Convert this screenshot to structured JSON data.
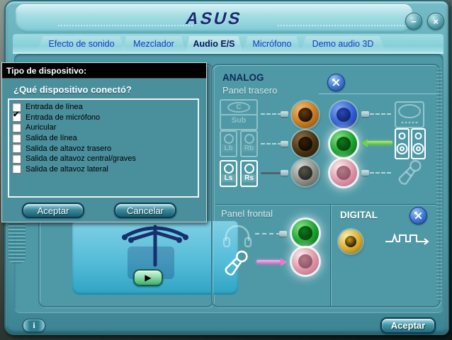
{
  "window": {
    "brand": "ASUS",
    "minimize_glyph": "−",
    "close_glyph": "×"
  },
  "tabs": [
    {
      "label": "Efecto de sonido"
    },
    {
      "label": "Mezclador"
    },
    {
      "label": "Audio E/S"
    },
    {
      "label": "Micrófono"
    },
    {
      "label": "Demo audio 3D"
    }
  ],
  "active_tab": "Audio E/S",
  "dialog": {
    "title": "Tipo de dispositivo:",
    "question": "¿Qué dispositivo conectó?",
    "options": [
      {
        "label": "Entrada de línea",
        "checked": false,
        "mark": ""
      },
      {
        "label": "Entrada de micrófono",
        "checked": true,
        "mark": "✔"
      },
      {
        "label": "Auricular",
        "checked": false,
        "mark": ""
      },
      {
        "label": "Salida de línea",
        "checked": false,
        "mark": ""
      },
      {
        "label": "Salida de altavoz trasero",
        "checked": false,
        "mark": ""
      },
      {
        "label": "Salida de altavoz central/graves",
        "checked": false,
        "mark": ""
      },
      {
        "label": "Salida de altavoz lateral",
        "checked": false,
        "mark": ""
      }
    ],
    "accept_label": "Aceptar",
    "cancel_label": "Cancelar"
  },
  "analog": {
    "title": "ANALOG",
    "rear_panel_label": "Panel trasero",
    "front_panel_label": "Panel frontal",
    "speakers": {
      "center": "C",
      "sub": "Sub",
      "left_back": "Lb",
      "right_back": "Rb",
      "left_side": "Ls",
      "right_side": "Rs"
    }
  },
  "digital": {
    "title": "DIGITAL"
  },
  "player": {
    "play_glyph": "▶"
  },
  "footer": {
    "info_glyph": "i",
    "accept_label": "Aceptar"
  },
  "colors": {
    "jack_orange": "#c6791f",
    "jack_black": "#473113",
    "jack_gray": "#8d8d88",
    "jack_blue": "#2e5fd2",
    "jack_green": "#17a12b",
    "jack_pink": "#dd93a5",
    "jack_gold": "#d6ab2e",
    "window_teal": "#57a3b0",
    "panel_teal": "#4f99a6",
    "tab_blue": "#1538cc",
    "active_tab_navy": "#0a1560",
    "logo_navy": "#1c2a72"
  }
}
